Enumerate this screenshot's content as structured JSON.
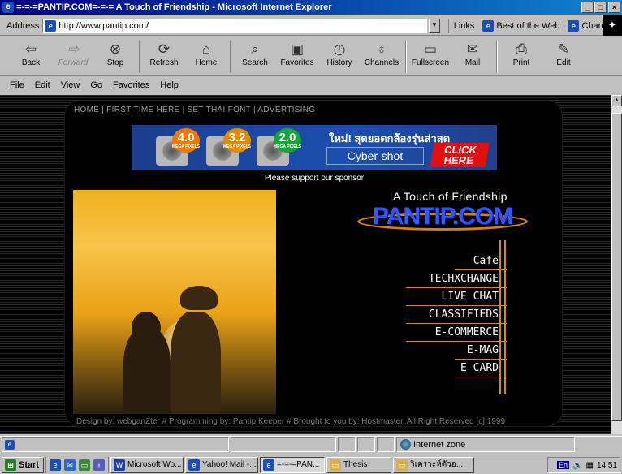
{
  "window": {
    "title": "=-=-=PANTIP.COM=-=-= A Touch of Friendship - Microsoft Internet Explorer",
    "minimize": "_",
    "maximize": "□",
    "close": "×"
  },
  "address": {
    "label": "Address",
    "url": "http://www.pantip.com/",
    "links_label": "Links",
    "links": [
      "Best of the Web",
      "Channel"
    ]
  },
  "toolbar": {
    "buttons": [
      {
        "label": "Back",
        "icon": "back-arrow-icon",
        "glyph": "⇦",
        "disabled": false
      },
      {
        "label": "Forward",
        "icon": "forward-arrow-icon",
        "glyph": "⇨",
        "disabled": true
      },
      {
        "label": "Stop",
        "icon": "stop-icon",
        "glyph": "⊗",
        "disabled": false
      },
      {
        "label": "Refresh",
        "icon": "refresh-icon",
        "glyph": "⟳",
        "disabled": false
      },
      {
        "label": "Home",
        "icon": "home-icon",
        "glyph": "⌂",
        "disabled": false
      },
      {
        "label": "Search",
        "icon": "search-icon",
        "glyph": "⌕",
        "disabled": false
      },
      {
        "label": "Favorites",
        "icon": "favorites-icon",
        "glyph": "▣",
        "disabled": false
      },
      {
        "label": "History",
        "icon": "history-icon",
        "glyph": "◷",
        "disabled": false
      },
      {
        "label": "Channels",
        "icon": "channels-icon",
        "glyph": "♁",
        "disabled": false
      },
      {
        "label": "Fullscreen",
        "icon": "fullscreen-icon",
        "glyph": "▭",
        "disabled": false
      },
      {
        "label": "Mail",
        "icon": "mail-icon",
        "glyph": "✉",
        "disabled": false
      },
      {
        "label": "Print",
        "icon": "print-icon",
        "glyph": "⎙",
        "disabled": false
      },
      {
        "label": "Edit",
        "icon": "edit-icon",
        "glyph": "✎",
        "disabled": false
      }
    ]
  },
  "menu": [
    "File",
    "Edit",
    "View",
    "Go",
    "Favorites",
    "Help"
  ],
  "page": {
    "topnav": "HOME  |  FIRST TIME HERE  |  SET THAI FONT  |  ADVERTISING",
    "banner": {
      "badges": [
        {
          "value": "4.0",
          "unit": "MEGA PIXELS"
        },
        {
          "value": "3.2",
          "unit": "MEGA PIXELS"
        },
        {
          "value": "2.0",
          "unit": "MEGA PIXELS"
        }
      ],
      "thai_headline": "ใหม่! สุดยอดกล้องรุ่นล่าสุด",
      "product": "Cyber-shot",
      "cta": "CLICK HERE"
    },
    "sponsor_text": "Please support our sponsor",
    "tagline": "A Touch of Friendship",
    "logo": "PANTIP.COM",
    "nav": [
      "Cafe",
      "TECHXCHANGE",
      "LIVE CHAT",
      "CLASSIFIEDS",
      "E-COMMERCE",
      "E-MAG",
      "E-CARD"
    ],
    "footer": "Design by: webganZter # Programming by: Pantip Keeper # Brought to you by: Hostmaster.     All Right Reserved [c] 1999"
  },
  "status": {
    "zone": "Internet zone"
  },
  "taskbar": {
    "start": "Start",
    "tasks": [
      {
        "label": "Microsoft Wo...",
        "color": "#1f3fa0",
        "glyph": "W",
        "active": false
      },
      {
        "label": "Yahoo! Mail -...",
        "color": "#1a4fb8",
        "glyph": "e",
        "active": false
      },
      {
        "label": "=-=-=PAN...",
        "color": "#1a4fb8",
        "glyph": "e",
        "active": true
      },
      {
        "label": "Thesis",
        "color": "#d6b04a",
        "glyph": "▭",
        "active": false
      },
      {
        "label": "วิเคราะห์ตัวอ...",
        "color": "#d6b04a",
        "glyph": "▭",
        "active": false
      }
    ],
    "lang": "En",
    "clock": "14:51"
  }
}
